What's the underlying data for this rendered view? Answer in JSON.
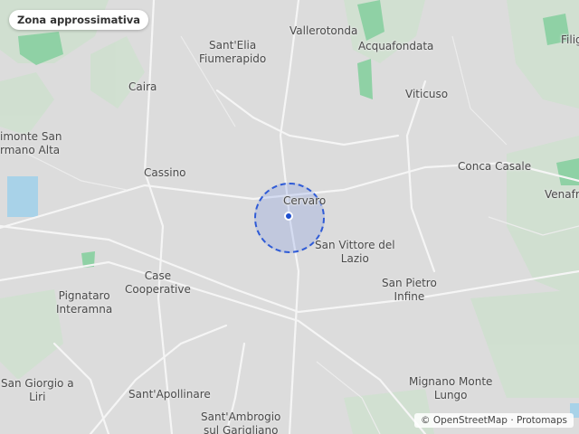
{
  "map": {
    "badge_label": "Zona approssimativa",
    "attribution": {
      "osm": "© OpenStreetMap",
      "separator": "·",
      "tiles": "Protomaps"
    },
    "colors": {
      "land": "#dcdcdc",
      "green": "#cfe0cf",
      "park": "#8fd1a5",
      "water": "#a8d2e8",
      "road": "#f5f5f5",
      "zone_fill": "#466ee1",
      "zone_border": "#2f5bd6",
      "marker": "#1e4fcf"
    },
    "places": [
      {
        "id": "vallerotonda",
        "lines": [
          "Vallerotonda"
        ]
      },
      {
        "id": "santelia",
        "lines": [
          "Sant'Elia",
          "Fiumerapido"
        ]
      },
      {
        "id": "acquafondata",
        "lines": [
          "Acquafondata"
        ]
      },
      {
        "id": "filignano",
        "lines": [
          "Filig"
        ]
      },
      {
        "id": "caira",
        "lines": [
          "Caira"
        ]
      },
      {
        "id": "viticuso",
        "lines": [
          "Viticuso"
        ]
      },
      {
        "id": "piedimonte",
        "lines": [
          "imonte San",
          "rmano Alta"
        ]
      },
      {
        "id": "cassino",
        "lines": [
          "Cassino"
        ]
      },
      {
        "id": "conca",
        "lines": [
          "Conca Casale"
        ]
      },
      {
        "id": "venafro",
        "lines": [
          "Venafr"
        ]
      },
      {
        "id": "cervaro",
        "lines": [
          "Cervaro"
        ]
      },
      {
        "id": "santvittore",
        "lines": [
          "San Vittore del",
          "Lazio"
        ]
      },
      {
        "id": "case",
        "lines": [
          "Case",
          "Cooperative"
        ]
      },
      {
        "id": "sanpietro",
        "lines": [
          "San Pietro",
          "Infine"
        ]
      },
      {
        "id": "pignataro",
        "lines": [
          "Pignataro",
          "Interamna"
        ]
      },
      {
        "id": "mignano",
        "lines": [
          "Mignano Monte",
          "Lungo"
        ]
      },
      {
        "id": "sangiorgio",
        "lines": [
          "San Giorgio a",
          "Liri"
        ]
      },
      {
        "id": "santapollinare",
        "lines": [
          "Sant'Apollinare"
        ]
      },
      {
        "id": "santambrogio",
        "lines": [
          "Sant'Ambrogio",
          "sul Garigliano"
        ]
      }
    ]
  }
}
